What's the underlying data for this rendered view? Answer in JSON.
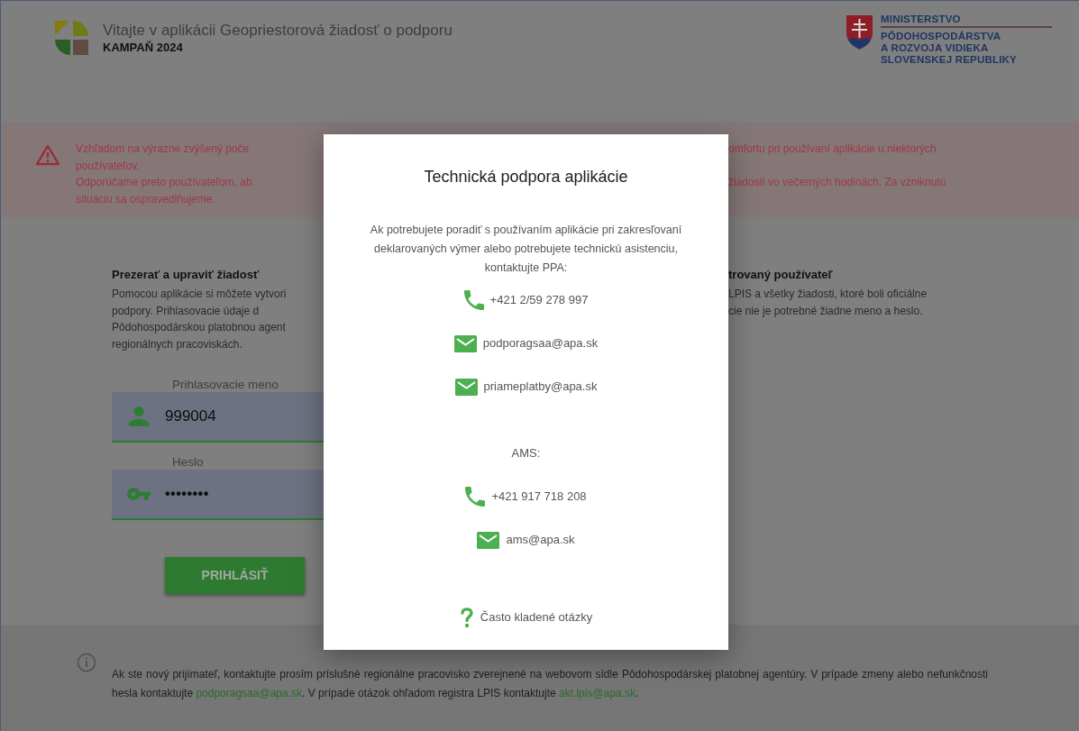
{
  "header": {
    "title": "Vitajte v aplikácii Geopriestorová žiadosť o podporu",
    "subtitle": "KAMPAŇ 2024",
    "ministry_logo": [
      "MINISTERSTVO",
      "PÔDOHOSPODÁRSTVA",
      "A ROZVOJA VIDIEKA",
      "SLOVENSKEJ REPUBLIKY"
    ]
  },
  "alert": {
    "left_lines": [
      "Vzhľadom na výrazne zvýšený poče",
      "používateľov.",
      "Odporúčame preto používateľom, ab",
      "situáciu sa ospravedlňujeme."
    ],
    "right_lines": [
      "omfortu pri používaní aplikácie u niektorých",
      "žiadosti vo večerných hodinách. Za vzniknutú"
    ]
  },
  "login": {
    "heading": "Prezerať a upraviť žiadosť",
    "text_lines": [
      "Pomocou aplikácie si môžete vytvori",
      "podpory. Prihlasovacie údaje d",
      "Pôdohospodárskou platobnou agent",
      "regionálnych pracoviskách."
    ],
    "fields": [
      {
        "kind": "username",
        "label": "Prihlasovacie meno",
        "value": "999004"
      },
      {
        "kind": "password",
        "label": "Heslo",
        "value": "••••••••"
      }
    ],
    "button": "PRIHLÁSIŤ"
  },
  "public": {
    "heading": "trovaný používateľ",
    "text_lines": [
      "LPIS a všetky žiadosti, ktoré boli oficiálne",
      "cie nie je potrebné žiadne meno a heslo."
    ]
  },
  "footer": {
    "parts": [
      {
        "kind": "text",
        "text": "Ak ste nový prijímateľ, kontaktujte prosím príslušné regionálne pracovisko zverejnené na webovom sídle Pôdohospodárskej platobnej agentúry. V prípade zmeny alebo nefunkčnosti hesla kontaktujte "
      },
      {
        "kind": "link",
        "text": "podporagsaa@apa.sk"
      },
      {
        "kind": "text",
        "text": ". V prípade otázok ohľadom registra LPIS kontaktujte "
      },
      {
        "kind": "link",
        "text": "akt.lpis@apa.sk"
      },
      {
        "kind": "text",
        "text": "."
      }
    ]
  },
  "modal": {
    "title": "Technická podpora aplikácie",
    "intro": "Ak potrebujete poradiť s používaním aplikácie pri zakresľovaní deklarovaných výmer alebo potrebujete technickú asistenciu, kontaktujte PPA:",
    "contacts": [
      {
        "kind": "phone",
        "text": "+421 2/59 278 997"
      },
      {
        "kind": "email",
        "text": "podporagsaa@apa.sk"
      },
      {
        "kind": "email",
        "text": "priameplatby@apa.sk"
      },
      {
        "kind": "heading",
        "text": "AMS:"
      },
      {
        "kind": "phone",
        "text": "+421 917 718 208"
      },
      {
        "kind": "email",
        "text": "ams@apa.sk"
      },
      {
        "kind": "faq",
        "text": "Často kladené otázky"
      }
    ]
  }
}
